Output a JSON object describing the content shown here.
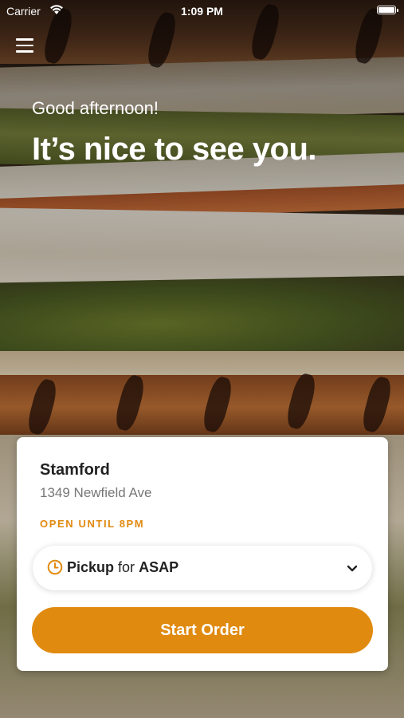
{
  "status_bar": {
    "carrier": "Carrier",
    "time": "1:09 PM",
    "battery_level": 1.0
  },
  "header": {
    "menu_icon": "hamburger-menu-icon",
    "greeting": "Good afternoon!",
    "headline": "It’s nice to see you."
  },
  "store_card": {
    "location_name": "Stamford",
    "address": "1349 Newfield Ave",
    "hours_status": "OPEN UNTIL 8PM",
    "order_type": {
      "icon": "clock-icon",
      "mode": "Pickup",
      "connector": "for",
      "when": "ASAP",
      "chevron_icon": "chevron-down-icon"
    },
    "start_order_label": "Start Order"
  },
  "colors": {
    "accent": "#E08A10",
    "card_background": "#FFFFFF",
    "text_primary": "#222222",
    "text_secondary": "#777777"
  }
}
